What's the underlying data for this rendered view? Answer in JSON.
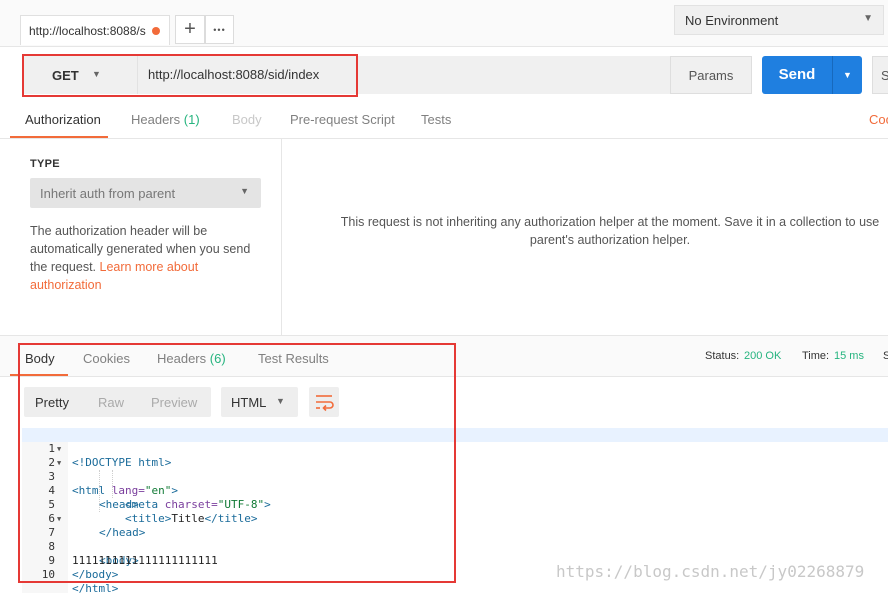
{
  "tab": {
    "title": "http://localhost:8088/s",
    "add_label": "+",
    "more_label": "•••"
  },
  "environment": {
    "selected": "No Environment"
  },
  "request": {
    "method": "GET",
    "url": "http://localhost:8088/sid/index",
    "params_label": "Params",
    "send_label": "Send",
    "save_label": "S"
  },
  "request_tabs": {
    "authorization": "Authorization",
    "headers": "Headers",
    "headers_count": "(1)",
    "body": "Body",
    "prerequest": "Pre-request Script",
    "tests": "Tests",
    "code_link": "Coo"
  },
  "auth": {
    "type_label": "TYPE",
    "type_value": "Inherit auth from parent",
    "description": "The authorization header will be automatically generated when you send the request.",
    "learn_more_line1": "Learn more about",
    "learn_more_line2": "authorization",
    "message_line1": "This request is not inheriting any authorization helper at the moment. Save it in a collection to use",
    "message_line2": "parent's authorization helper."
  },
  "response": {
    "tabs": {
      "body": "Body",
      "cookies": "Cookies",
      "headers": "Headers",
      "headers_count": "(6)",
      "test_results": "Test Results"
    },
    "status_label": "Status:",
    "status_value": "200 OK",
    "time_label": "Time:",
    "time_value": "15 ms",
    "size_label": "S",
    "view_modes": {
      "pretty": "Pretty",
      "raw": "Raw",
      "preview": "Preview"
    },
    "format": "HTML",
    "code": {
      "l1": {
        "n": "1",
        "a": "<!DOCTYPE html>"
      },
      "l2": {
        "n": "2",
        "open": "<html ",
        "attr": "lang=",
        "val": "\"en\"",
        "close": ">"
      },
      "l3": {
        "n": "3",
        "a": "<head>"
      },
      "l4": {
        "n": "4",
        "open": "<meta ",
        "attr": "charset=",
        "val": "\"UTF-8\"",
        "close": ">"
      },
      "l5": {
        "n": "5",
        "open": "<title>",
        "text": "Title",
        "close": "</title>"
      },
      "l6": {
        "n": "6",
        "a": "</head>"
      },
      "l7": {
        "n": "7",
        "a": "<body>"
      },
      "l8": {
        "n": "8",
        "text": "1111111111111111111111"
      },
      "l9": {
        "n": "9",
        "a": "</body>"
      },
      "l10": {
        "n": "10",
        "a": "</html>"
      }
    }
  },
  "watermark": "https://blog.csdn.net/jy02268879",
  "colors": {
    "accent": "#f26b3a",
    "send": "#1f7fe0",
    "status_ok": "#26b47f",
    "highlight_box": "#e53935"
  }
}
